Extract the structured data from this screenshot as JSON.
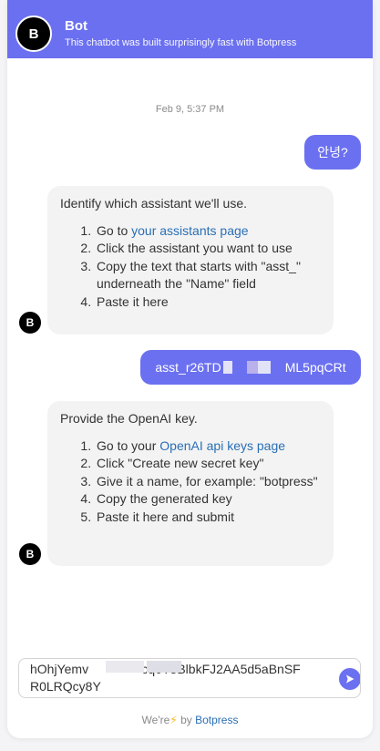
{
  "header": {
    "avatar_letter": "B",
    "bot_name": "Bot",
    "description": "This chatbot was built surprisingly fast with Botpress"
  },
  "messages": {
    "timestamp": "Feb 9, 5:37 PM",
    "user_greeting": "안녕?",
    "bot1": {
      "intro": "Identify which assistant we'll use.",
      "step1_prefix": "Go to ",
      "step1_link": "your assistants page",
      "step2": "Click the assistant you want to use",
      "step3": "Copy the text that starts with \"asst_\" underneath the \"Name\" field",
      "step4": "Paste it here"
    },
    "user_asst_id_start": "asst_r26TD",
    "user_asst_id_end": "ML5pqCRt",
    "bot2": {
      "intro": "Provide the OpenAI key.",
      "step1_prefix": "Go to your ",
      "step1_link": "OpenAI api keys page",
      "step2": "Click \"Create new secret key\"",
      "step3": "Give it a name, for example: \"botpress\"",
      "step4": "Copy the generated key",
      "step5": "Paste it here and submit"
    },
    "bot_avatar_letter": "B"
  },
  "composer": {
    "value": "hOhjYemv               cq0T3BlbkFJ2AA5d5aBnSF R0LRQcy8Y"
  },
  "footer": {
    "prefix": "We're",
    "bolt": "⚡",
    "by": "by",
    "brand": "Botpress"
  },
  "colors": {
    "accent": "#6b70f0",
    "link": "#2a6fb5",
    "bubble_bot": "#f3f3f3"
  }
}
